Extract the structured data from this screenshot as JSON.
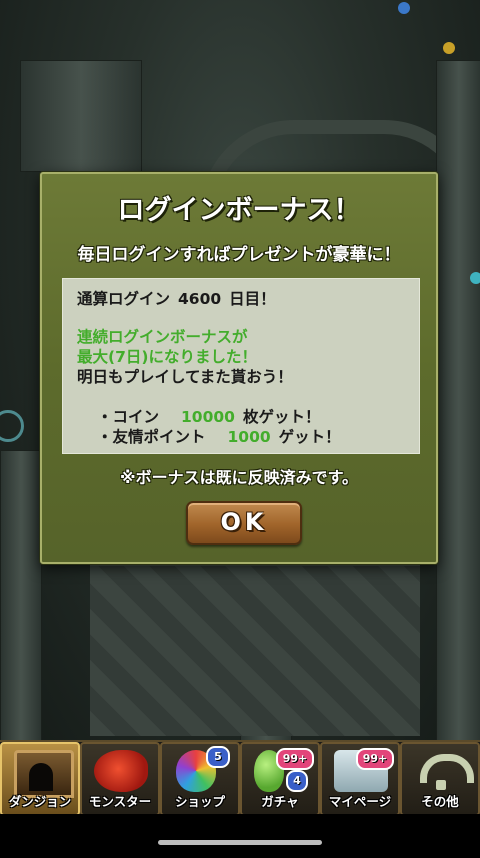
{
  "modal": {
    "title": "ログインボーナス！",
    "subtitle": "毎日ログインすればプレゼントが豪華に！",
    "total_login_prefix": "通算ログイン",
    "total_login_days": "4600",
    "total_login_suffix": "日目！",
    "streak_line1": "連続ログインボーナスが",
    "streak_line2": "最大(7日)になりました！",
    "tomorrow_line": "明日もプレイしてまた貰おう！",
    "reward_coin_label": "・コイン",
    "reward_coin_value": "10000",
    "reward_coin_suffix": "枚ゲット！",
    "reward_friend_label": "・友情ポイント",
    "reward_friend_value": "1000",
    "reward_friend_suffix": "ゲット！",
    "note": "※ボーナスは既に反映済みです。",
    "ok_label": "OK",
    "highlight_color": "#43ad2c"
  },
  "nav": {
    "items": [
      {
        "label": "ダンジョン",
        "icon": "dungeon-gate-icon",
        "active": true
      },
      {
        "label": "モンスター",
        "icon": "red-dragon-icon"
      },
      {
        "label": "ショップ",
        "icon": "rainbow-egg-icon",
        "badge": "5"
      },
      {
        "label": "ガチャ",
        "icon": "egg-icon",
        "badge": "99+",
        "badge2": "4"
      },
      {
        "label": "マイページ",
        "icon": "mail-icon",
        "badge": "99+"
      },
      {
        "label": "その他",
        "icon": "question-mark-icon"
      }
    ]
  }
}
